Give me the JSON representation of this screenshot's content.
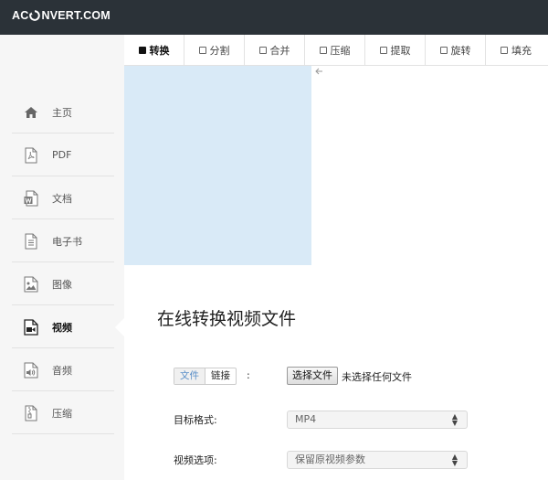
{
  "header": {
    "logo_left": "AC",
    "logo_right": "NVERT.COM"
  },
  "sidebar": {
    "items": [
      {
        "label": "主页",
        "icon": "home-icon"
      },
      {
        "label": "PDF",
        "icon": "pdf-file-icon"
      },
      {
        "label": "文档",
        "icon": "word-document-icon"
      },
      {
        "label": "电子书",
        "icon": "ebook-icon"
      },
      {
        "label": "图像",
        "icon": "image-icon"
      },
      {
        "label": "视频",
        "icon": "video-icon",
        "active": true
      },
      {
        "label": "音频",
        "icon": "audio-icon"
      },
      {
        "label": "压缩",
        "icon": "archive-icon"
      }
    ]
  },
  "tabs": [
    {
      "label": "转换",
      "active": true
    },
    {
      "label": "分割"
    },
    {
      "label": "合并"
    },
    {
      "label": "压缩"
    },
    {
      "label": "提取"
    },
    {
      "label": "旋转"
    },
    {
      "label": "填充"
    }
  ],
  "main": {
    "title": "在线转换视频文件",
    "source": {
      "file_tab": "文件",
      "link_tab": "链接",
      "colon": ":"
    },
    "file_button": "选择文件",
    "file_status": "未选择任何文件",
    "target_format": {
      "label": "目标格式:",
      "value": "MP4"
    },
    "video_options": {
      "label": "视频选项:",
      "value": "保留原视频参数"
    }
  },
  "colors": {
    "topbar": "#2b3238",
    "blue_panel": "#d9eaf7",
    "link_blue": "#5a8fc8"
  }
}
